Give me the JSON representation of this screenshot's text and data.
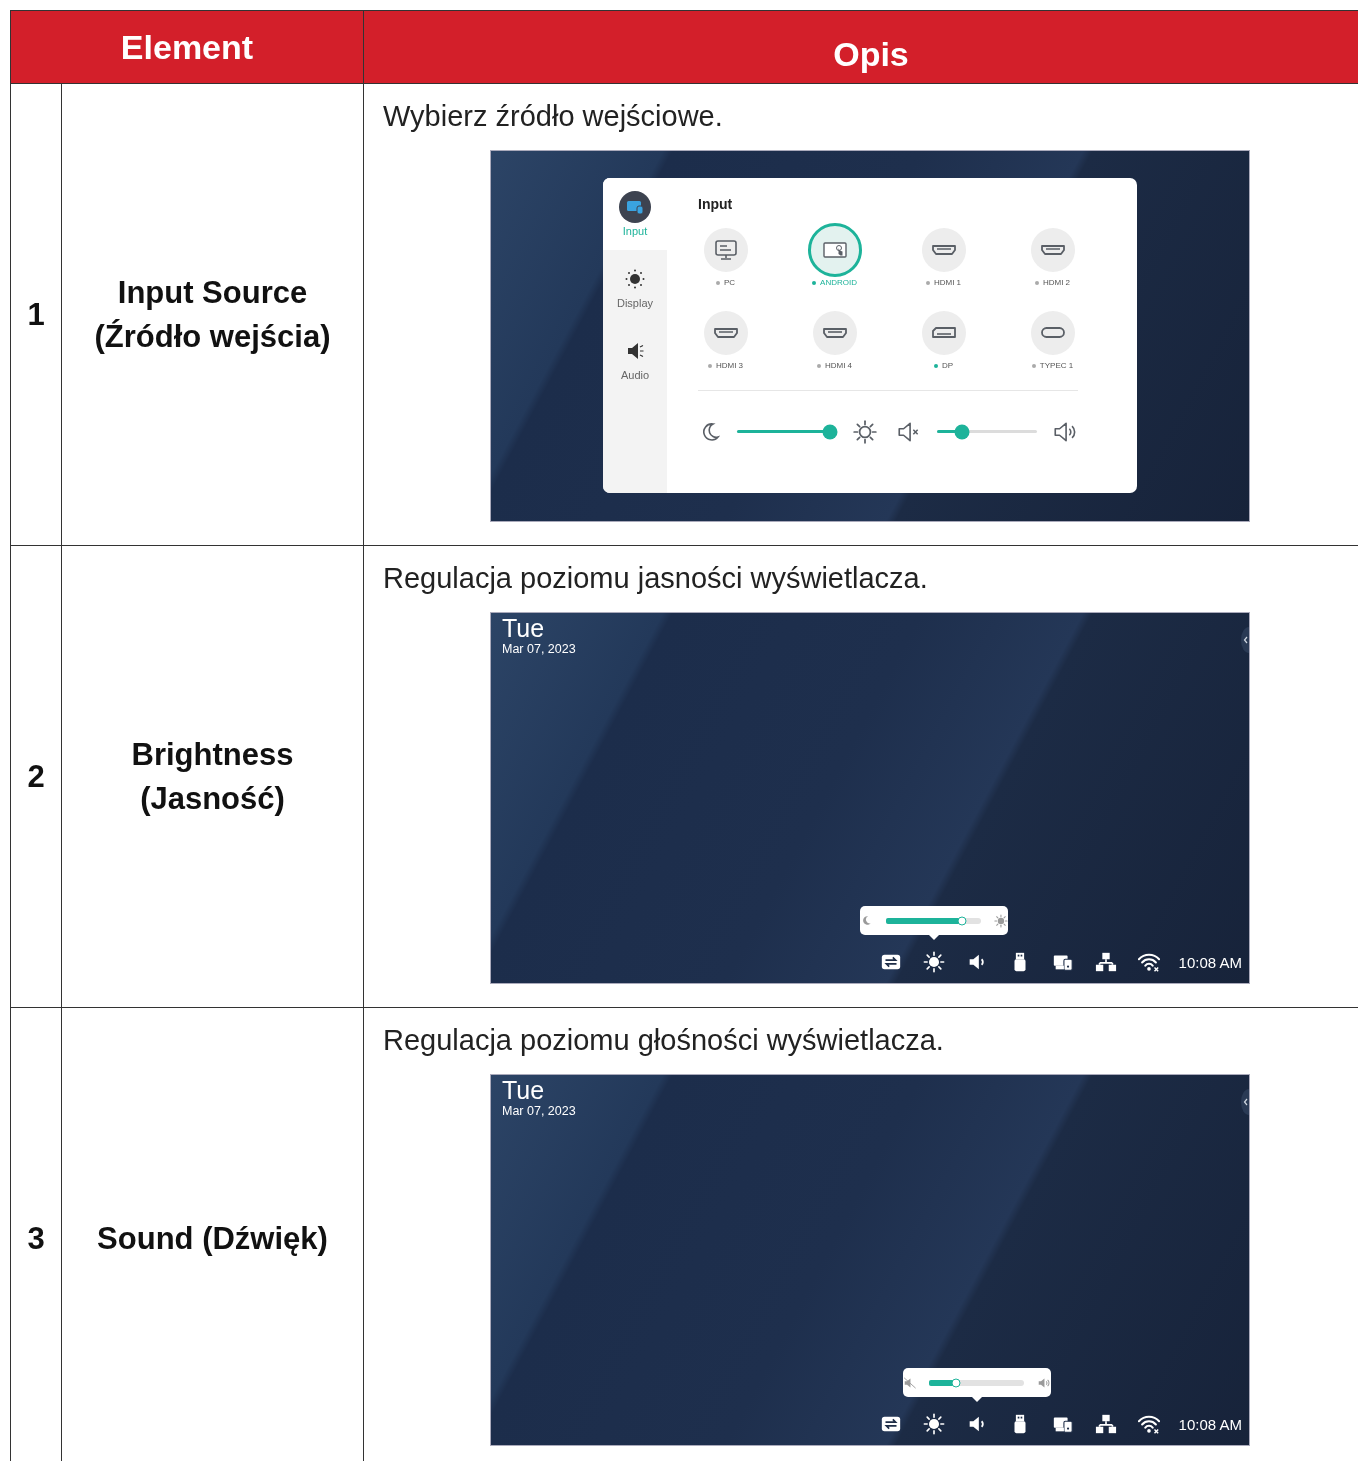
{
  "table": {
    "columns": [
      "Element",
      "Opis"
    ],
    "rows": [
      {
        "number": "1",
        "element": [
          "Input Source",
          "(Źródło wejścia)"
        ],
        "description": "Wybierz źródło wejściowe.",
        "screen": {
          "kind": "input_menu",
          "sidebar": [
            {
              "kind": "input",
              "label": "Input",
              "selected": true
            },
            {
              "kind": "display",
              "label": "Display",
              "selected": false
            },
            {
              "kind": "audio",
              "label": "Audio",
              "selected": false
            }
          ],
          "title": "Input",
          "sources": [
            {
              "kind": "pc",
              "label": "PC",
              "selected": false,
              "signal": false
            },
            {
              "kind": "android",
              "label": "ANDROID",
              "selected": true,
              "signal": true
            },
            {
              "kind": "hdmi",
              "label": "HDMI 1",
              "selected": false,
              "signal": false
            },
            {
              "kind": "hdmi",
              "label": "HDMI 2",
              "selected": false,
              "signal": false
            },
            {
              "kind": "hdmi",
              "label": "HDMI 3",
              "selected": false,
              "signal": false
            },
            {
              "kind": "hdmi",
              "label": "HDMI 4",
              "selected": false,
              "signal": false
            },
            {
              "kind": "dp",
              "label": "DP",
              "selected": false,
              "signal": true
            },
            {
              "kind": "typec",
              "label": "TYPEC 1",
              "selected": false,
              "signal": false
            }
          ],
          "brightness": {
            "level": 0.93
          },
          "volume": {
            "level": 0.25
          }
        }
      },
      {
        "number": "2",
        "element": [
          "Brightness",
          "(Jasność)"
        ],
        "description": "Regulacja poziomu jasności wyświetlacza.",
        "screen": {
          "kind": "desktop",
          "day": "Tue",
          "date": "Mar 07, 2023",
          "popup": {
            "kind": "brightness",
            "level": 0.8
          },
          "time": "10:08 AM"
        }
      },
      {
        "number": "3",
        "element": [
          "Sound (Dźwięk)"
        ],
        "description": "Regulacja poziomu głośności wyświetlacza.",
        "screen": {
          "kind": "desktop",
          "day": "Tue",
          "date": "Mar 07, 2023",
          "popup": {
            "kind": "volume",
            "level": 0.28
          },
          "time": "10:08 AM"
        }
      }
    ]
  }
}
